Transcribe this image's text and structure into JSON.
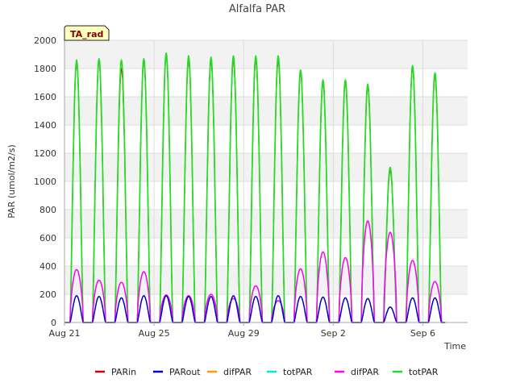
{
  "chart_data": {
    "type": "line",
    "title": "Alfalfa PAR",
    "xlabel": "Time",
    "ylabel": "PAR (umol/m2/s)",
    "ylim": [
      0,
      2000
    ],
    "yticks": [
      0,
      200,
      400,
      600,
      800,
      1000,
      1200,
      1400,
      1600,
      1800,
      2000
    ],
    "xlim": [
      "2023-08-21",
      "2023-09-08"
    ],
    "xticks": [
      {
        "date": "2023-08-21",
        "label": "Aug 21"
      },
      {
        "date": "2023-08-25",
        "label": "Aug 25"
      },
      {
        "date": "2023-08-29",
        "label": "Aug 29"
      },
      {
        "date": "2023-09-02",
        "label": "Sep 2"
      },
      {
        "date": "2023-09-06",
        "label": "Sep 6"
      }
    ],
    "grid": true,
    "legend_position": "bottom",
    "badge": "TA_rad",
    "day_start_hour": 6,
    "day_end_hour": 20,
    "days": [
      {
        "date": "2023-08-21",
        "totPAR": 1860,
        "PARin": 1840,
        "PARout": 190,
        "difPAR": 375
      },
      {
        "date": "2023-08-22",
        "totPAR": 1870,
        "PARin": 1850,
        "PARout": 185,
        "difPAR": 300
      },
      {
        "date": "2023-08-23",
        "totPAR": 1860,
        "PARin": 1800,
        "PARout": 175,
        "difPAR": 285
      },
      {
        "date": "2023-08-24",
        "totPAR": 1870,
        "PARin": 1850,
        "PARout": 190,
        "difPAR": 360
      },
      {
        "date": "2023-08-25",
        "totPAR": 1910,
        "PARin": 1890,
        "PARout": 190,
        "difPAR": 195
      },
      {
        "date": "2023-08-26",
        "totPAR": 1890,
        "PARin": 1860,
        "PARout": 185,
        "difPAR": 190
      },
      {
        "date": "2023-08-27",
        "totPAR": 1880,
        "PARin": 1850,
        "PARout": 185,
        "difPAR": 200
      },
      {
        "date": "2023-08-28",
        "totPAR": 1890,
        "PARin": 1860,
        "PARout": 190,
        "difPAR": 170
      },
      {
        "date": "2023-08-29",
        "totPAR": 1890,
        "PARin": 1860,
        "PARout": 185,
        "difPAR": 260
      },
      {
        "date": "2023-08-30",
        "totPAR": 1890,
        "PARin": 1860,
        "PARout": 190,
        "difPAR": 155
      },
      {
        "date": "2023-08-31",
        "totPAR": 1790,
        "PARin": 1770,
        "PARout": 185,
        "difPAR": 380
      },
      {
        "date": "2023-09-01",
        "totPAR": 1720,
        "PARin": 1700,
        "PARout": 180,
        "difPAR": 500
      },
      {
        "date": "2023-09-02",
        "totPAR": 1720,
        "PARin": 1700,
        "PARout": 175,
        "difPAR": 460
      },
      {
        "date": "2023-09-03",
        "totPAR": 1690,
        "PARin": 1670,
        "PARout": 170,
        "difPAR": 720
      },
      {
        "date": "2023-09-04",
        "totPAR": 1100,
        "PARin": 1080,
        "PARout": 110,
        "difPAR": 640
      },
      {
        "date": "2023-09-05",
        "totPAR": 1820,
        "PARin": 1800,
        "PARout": 175,
        "difPAR": 440
      },
      {
        "date": "2023-09-06",
        "totPAR": 1770,
        "PARin": 1750,
        "PARout": 175,
        "difPAR": 290
      }
    ],
    "series": [
      {
        "name": "PARin",
        "color": "#cc0000",
        "key": "PARin"
      },
      {
        "name": "PARout",
        "color": "#0000cc",
        "key": "PARout"
      },
      {
        "name": "difPAR",
        "color": "#ff9900",
        "key": "difPAR"
      },
      {
        "name": "totPAR",
        "color": "#00e5e5",
        "key": "totPAR"
      },
      {
        "name": "difPAR",
        "color": "#ff00ff",
        "key": "difPAR"
      },
      {
        "name": "totPAR",
        "color": "#22dd22",
        "key": "totPAR"
      }
    ]
  }
}
